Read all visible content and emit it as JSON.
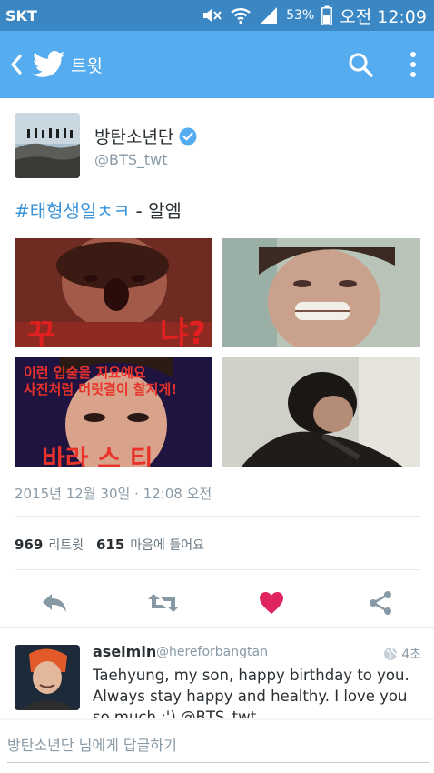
{
  "status_bar": {
    "carrier": "SKT",
    "battery": "53%",
    "time": "오전 12:09"
  },
  "app_bar": {
    "title": "트윗"
  },
  "tweet": {
    "author_name": "방탄소년단",
    "author_handle": "@BTS_twt",
    "hashtag": "#태형생일ㅊㅋ",
    "text_suffix": " - 알엠",
    "timestamp": "2015년 12월 30일 · 12:08 오전",
    "retweet_count": "969",
    "retweet_label": "리트윗",
    "like_count": "615",
    "like_label": "마음에 들어요"
  },
  "reply": {
    "name": "aselmin",
    "handle": "@hereforbangtan",
    "time": "4초",
    "text": "Taehyung, my son, happy birthday to you. Always stay happy and healthy. I love you so much :') @BTS_twt"
  },
  "composer": {
    "placeholder": "방탄소년단 님에게 답글하기"
  },
  "colors": {
    "app_bar": "#55acee",
    "status_bar": "#3a87c4",
    "heart": "#e0245e",
    "hashtag": "#3b94d9"
  }
}
